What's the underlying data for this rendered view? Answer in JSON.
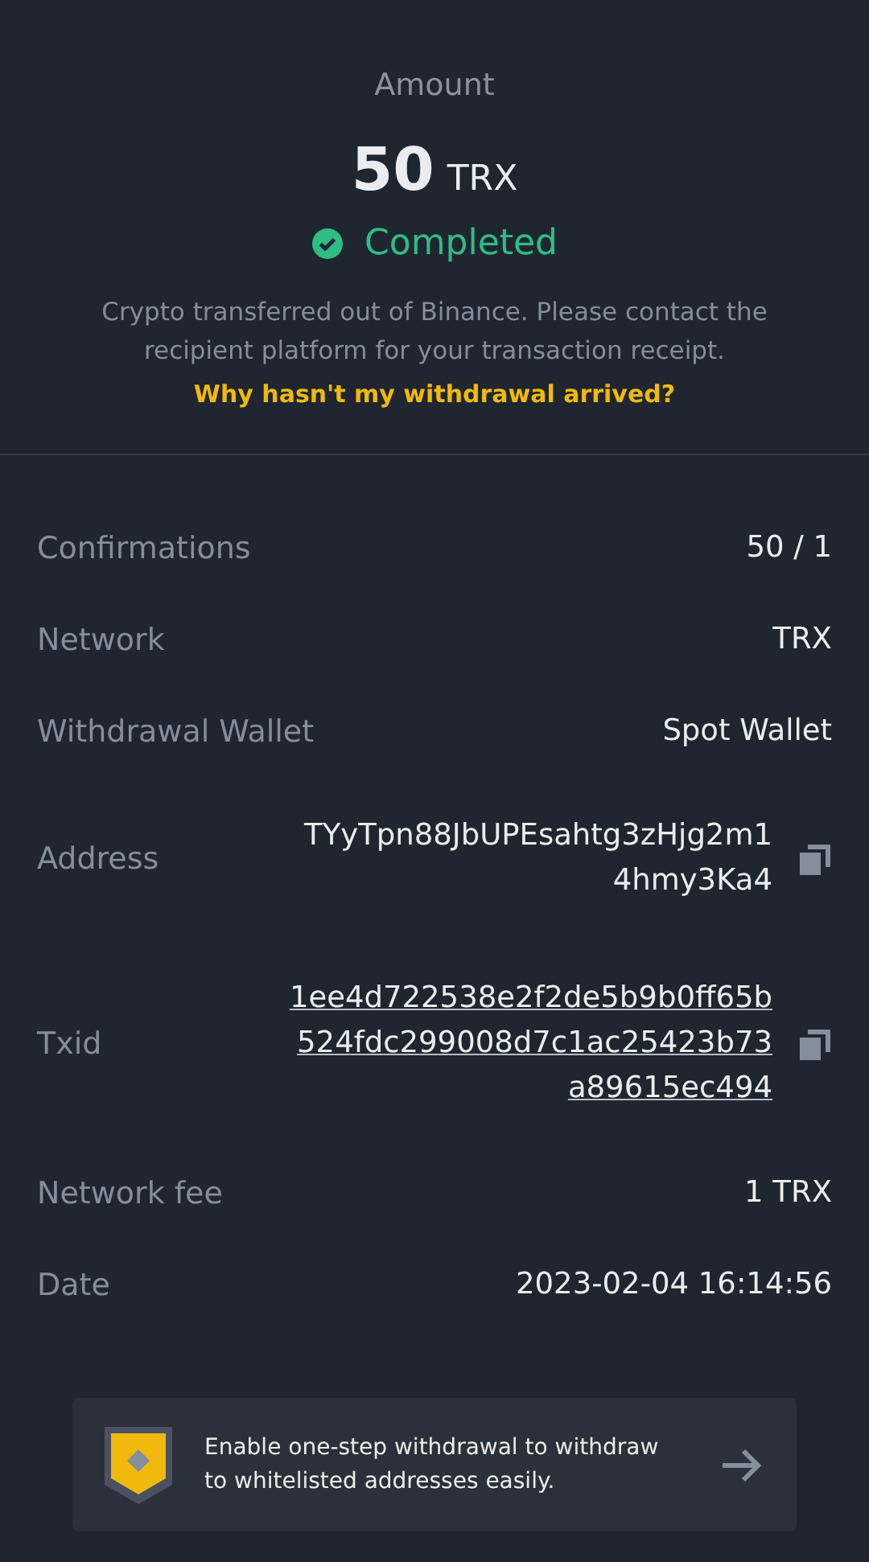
{
  "summary": {
    "label": "Amount",
    "amount": "50",
    "unit": "TRX",
    "status": {
      "kind": "completed",
      "text": "Completed"
    },
    "note": "Crypto transferred out of Binance. Please contact the recipient platform for your transaction receipt.",
    "help_link": "Why hasn't my withdrawal arrived?"
  },
  "details": [
    {
      "kind": "plain",
      "label": "Confirmations",
      "value_lines": [
        "50 / 1"
      ]
    },
    {
      "kind": "plain",
      "label": "Network",
      "value_lines": [
        "TRX"
      ]
    },
    {
      "kind": "plain",
      "label": "Withdrawal Wallet",
      "value_lines": [
        "Spot Wallet"
      ]
    },
    {
      "kind": "copy",
      "label": "Address",
      "value_lines": [
        "TYyTpn88JbUPEsahtg3zHjg2m1",
        "4hmy3Ka4"
      ]
    },
    {
      "kind": "link-copy",
      "label": "Txid",
      "value_lines": [
        "1ee4d722538e2f2de5b9b0ff65b",
        "524fdc299008d7c1ac25423b73",
        "a89615ec494"
      ]
    },
    {
      "kind": "plain",
      "label": "Network fee",
      "value_lines": [
        "1 TRX"
      ]
    },
    {
      "kind": "plain",
      "label": "Date",
      "value_lines": [
        "2023-02-04 16:14:56"
      ]
    }
  ],
  "banner": {
    "text": "Enable one-step withdrawal to withdraw to whitelisted addresses easily."
  }
}
